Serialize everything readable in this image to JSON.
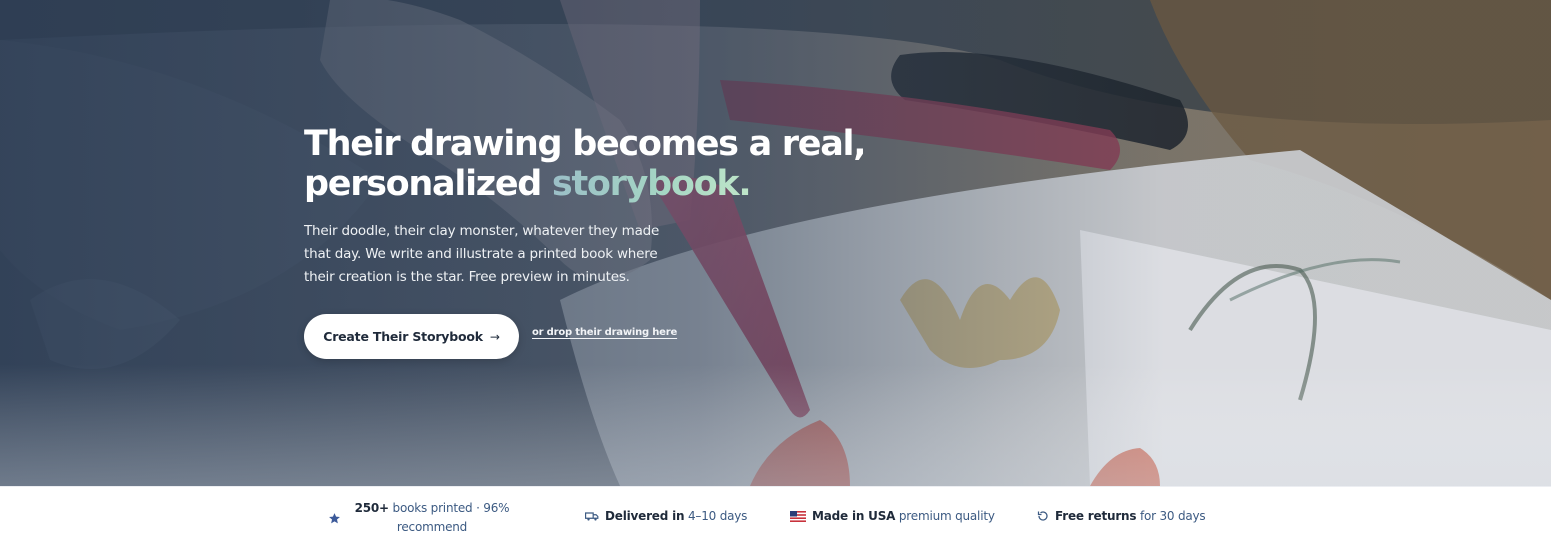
{
  "hero": {
    "headline_line1": "Their drawing becomes a real,",
    "headline_line2_plain": "personalized ",
    "headline_line2_accent": "storybook.",
    "subcopy_line1": "Their doodle, their clay monster, whatever they made",
    "subcopy_line2": "that day. We write and illustrate a printed book where",
    "subcopy_line3": "their creation is the star. Free preview in minutes.",
    "cta_label": "Create Their Storybook",
    "cta_arrow": "→",
    "drop_link": "or drop their drawing here"
  },
  "trust": {
    "books": {
      "bold": "250+",
      "text_line1": " books printed · 96%",
      "text_line2": "recommend",
      "icon": "star-icon"
    },
    "delivery": {
      "bold": "Delivered in",
      "text": " 4–10 days",
      "icon": "truck-icon"
    },
    "made": {
      "bold": "Made in USA",
      "text": " premium quality",
      "icon": "us-flag-icon"
    },
    "returns": {
      "bold": "Free returns",
      "text": " for 30 days",
      "icon": "return-icon"
    }
  },
  "colors": {
    "accent_gradient_start": "#9bbfc7",
    "accent_gradient_end": "#bfe6c9",
    "trust_text": "#3c5a82",
    "trust_bold": "#1f2a3a"
  }
}
